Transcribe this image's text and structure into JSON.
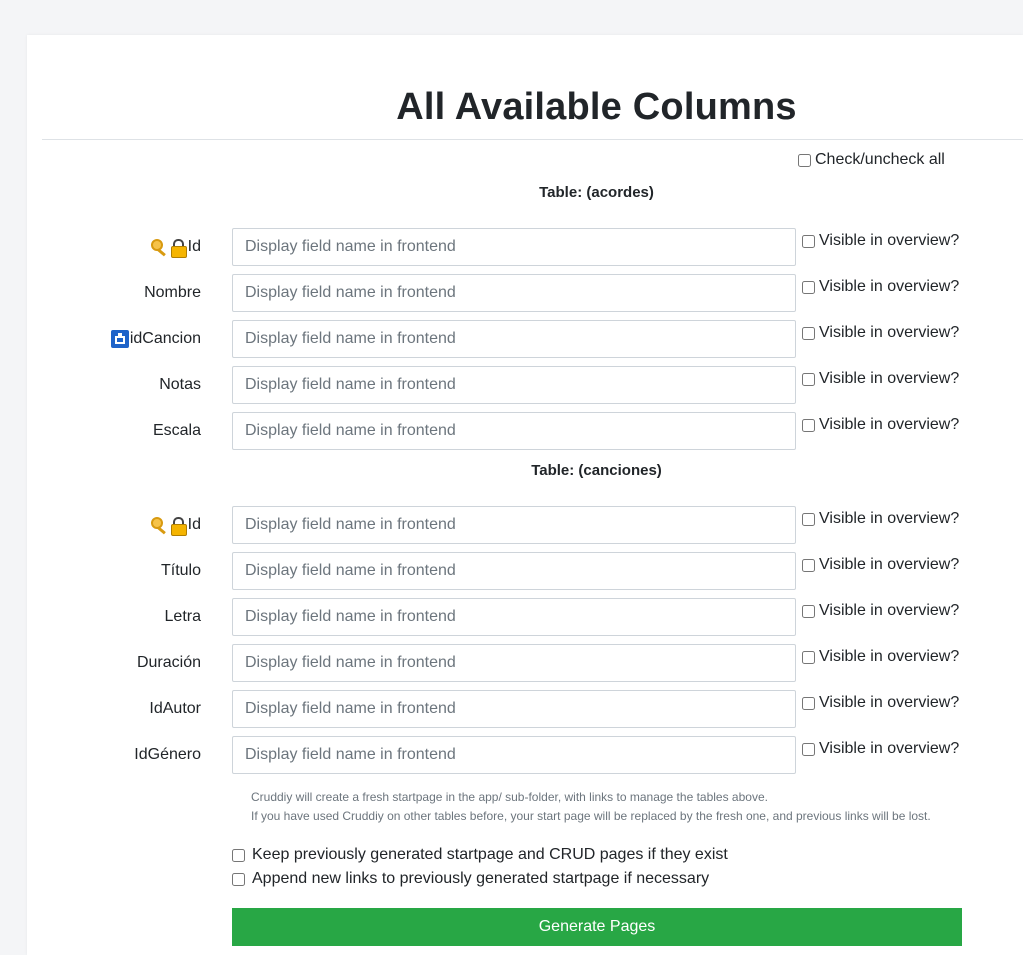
{
  "page": {
    "title": "All Available Columns",
    "check_all_label": "Check/uncheck all",
    "field_placeholder": "Display field name in frontend",
    "visible_label": "Visible in overview?"
  },
  "tables": [
    {
      "title": "Table: (acordes)",
      "columns": [
        {
          "name": "Id",
          "icons": [
            "key-icon",
            "lock-icon"
          ]
        },
        {
          "name": "Nombre",
          "icons": []
        },
        {
          "name": "idCancion",
          "icons": [
            "foreign-key-icon"
          ]
        },
        {
          "name": "Notas",
          "icons": []
        },
        {
          "name": "Escala",
          "icons": []
        }
      ]
    },
    {
      "title": "Table: (canciones)",
      "columns": [
        {
          "name": "Id",
          "icons": [
            "key-icon",
            "lock-icon"
          ]
        },
        {
          "name": "Título",
          "icons": []
        },
        {
          "name": "Letra",
          "icons": []
        },
        {
          "name": "Duración",
          "icons": []
        },
        {
          "name": "IdAutor",
          "icons": []
        },
        {
          "name": "IdGénero",
          "icons": []
        }
      ]
    }
  ],
  "info": {
    "line1": "Cruddiy will create a fresh startpage in the app/ sub-folder, with links to manage the tables above.",
    "line2": "If you have used Cruddiy on other tables before, your start page will be replaced by the fresh one, and previous links will be lost."
  },
  "options": {
    "keep_label": "Keep previously generated startpage and CRUD pages if they exist",
    "append_label": "Append new links to previously generated startpage if necessary"
  },
  "actions": {
    "generate_label": "Generate Pages"
  },
  "colors": {
    "primary_button": "#28a745"
  }
}
